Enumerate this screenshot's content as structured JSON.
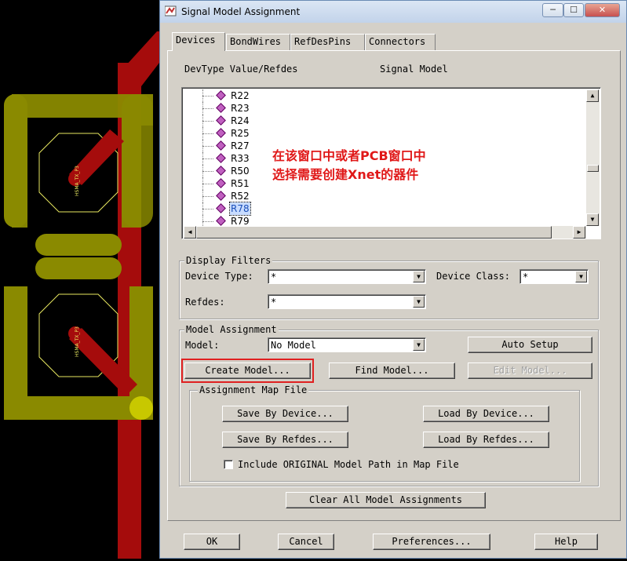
{
  "window": {
    "title": "Signal Model Assignment"
  },
  "tabs": [
    {
      "label": "Devices"
    },
    {
      "label": "BondWires"
    },
    {
      "label": "RefDesPins"
    },
    {
      "label": "Connectors"
    }
  ],
  "tree": {
    "headers": {
      "left": "DevType Value/Refdes",
      "right": "Signal Model"
    },
    "items": [
      "R22",
      "R23",
      "R24",
      "R25",
      "R27",
      "R33",
      "R50",
      "R51",
      "R52",
      "R78",
      "R79"
    ],
    "selected": "R78"
  },
  "annotation": {
    "line1": "在该窗口中或者PCB窗口中",
    "line2": "选择需要创建Xnet的器件",
    "color": "#e01818"
  },
  "display_filters": {
    "title": "Display Filters",
    "device_type_label": "Device Type:",
    "device_type_value": "*",
    "device_class_label": "Device Class:",
    "device_class_value": "*",
    "refdes_label": "Refdes:",
    "refdes_value": "*"
  },
  "model_assignment": {
    "title": "Model Assignment",
    "model_label": "Model:",
    "model_value": "No Model",
    "auto_setup": "Auto Setup",
    "create_model": "Create Model...",
    "find_model": "Find Model...",
    "edit_model": "Edit Model..."
  },
  "map_file": {
    "title": "Assignment Map File",
    "save_by_device": "Save By Device...",
    "load_by_device": "Load By Device...",
    "save_by_refdes": "Save By Refdes...",
    "load_by_refdes": "Load By Refdes...",
    "include_original": "Include ORIGINAL Model Path in Map File",
    "include_checked": false
  },
  "clear_all": "Clear All Model Assignments",
  "footer": {
    "ok": "OK",
    "cancel": "Cancel",
    "preferences": "Preferences...",
    "help": "Help"
  },
  "pcb": {
    "silk_top": "HSMA_TX_P3",
    "silk_bottom": "HSMA_TX_P3",
    "trace_color": "#b01010",
    "pad_color": "#8a8a00"
  }
}
